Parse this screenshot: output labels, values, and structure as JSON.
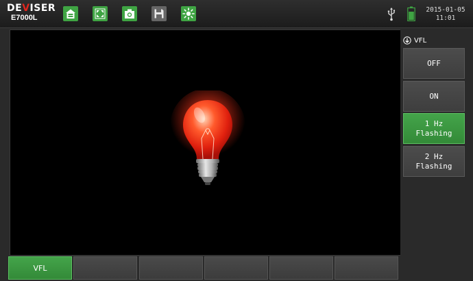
{
  "header": {
    "brand_left": "DE",
    "brand_mid": "V",
    "brand_right": "ISER",
    "model": "E7000L",
    "date": "2015-01-05",
    "time": "11:01",
    "icons": [
      "home-icon",
      "fullscreen-icon",
      "camera-icon",
      "save-icon",
      "brightness-icon",
      "usb-icon",
      "battery-icon"
    ]
  },
  "panel": {
    "title": "VFL",
    "buttons": [
      {
        "label": "OFF",
        "active": false
      },
      {
        "label": "ON",
        "active": false
      },
      {
        "label": "1 Hz\nFlashing",
        "active": true
      },
      {
        "label": "2 Hz\nFlashing",
        "active": false
      }
    ]
  },
  "tabs": [
    {
      "label": "VFL",
      "active": true
    },
    {
      "label": "",
      "active": false
    },
    {
      "label": "",
      "active": false
    },
    {
      "label": "",
      "active": false
    },
    {
      "label": "",
      "active": false
    },
    {
      "label": "",
      "active": false
    }
  ],
  "colors": {
    "accent": "#3fa443",
    "brand_red": "#e0261e",
    "bulb_glow": "#ff3b1f",
    "screen": "#000000"
  }
}
